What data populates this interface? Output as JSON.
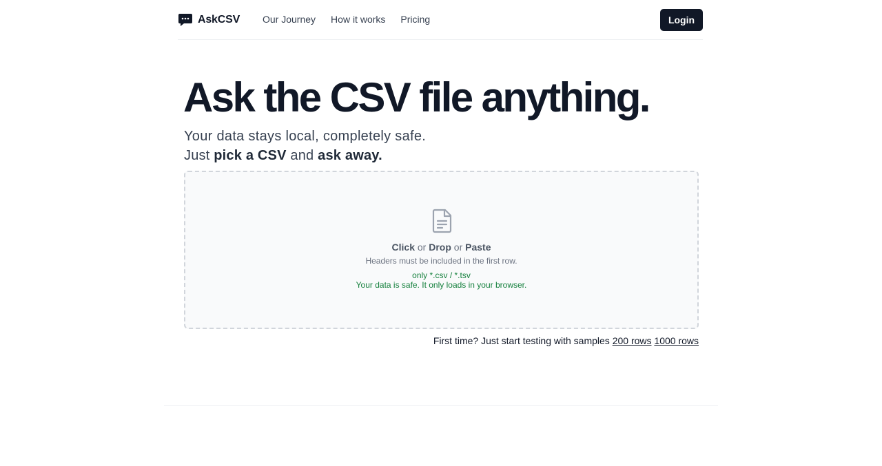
{
  "header": {
    "brand": "AskCSV",
    "nav": [
      {
        "label": "Our Journey"
      },
      {
        "label": "How it works"
      },
      {
        "label": "Pricing"
      }
    ],
    "login_label": "Login"
  },
  "hero": {
    "title": "Ask the CSV file anything.",
    "subtitle_line1": "Your data stays local, completely safe.",
    "subtitle_line2": {
      "prefix": "Just",
      "emph1": "pick a CSV",
      "middle": "and",
      "emph2": "ask away."
    }
  },
  "dropzone": {
    "icon": "document-icon",
    "action_click": "Click",
    "or1": "or",
    "action_drop": "Drop",
    "or2": "or",
    "action_paste": "Paste",
    "hint": "Headers must be included in the first row.",
    "file_types": "only *.csv / *.tsv",
    "safety_note": "Your data is safe. It only loads in your browser."
  },
  "samples": {
    "prompt": "First time? Just start testing with samples",
    "links": [
      {
        "label": "200 rows"
      },
      {
        "label": "1000 rows"
      }
    ]
  },
  "colors": {
    "primary": "#111827",
    "accent_green": "#15803d",
    "muted_text": "#6b7280",
    "dropzone_border": "#d1d5db",
    "dropzone_bg": "#f9fafb"
  }
}
